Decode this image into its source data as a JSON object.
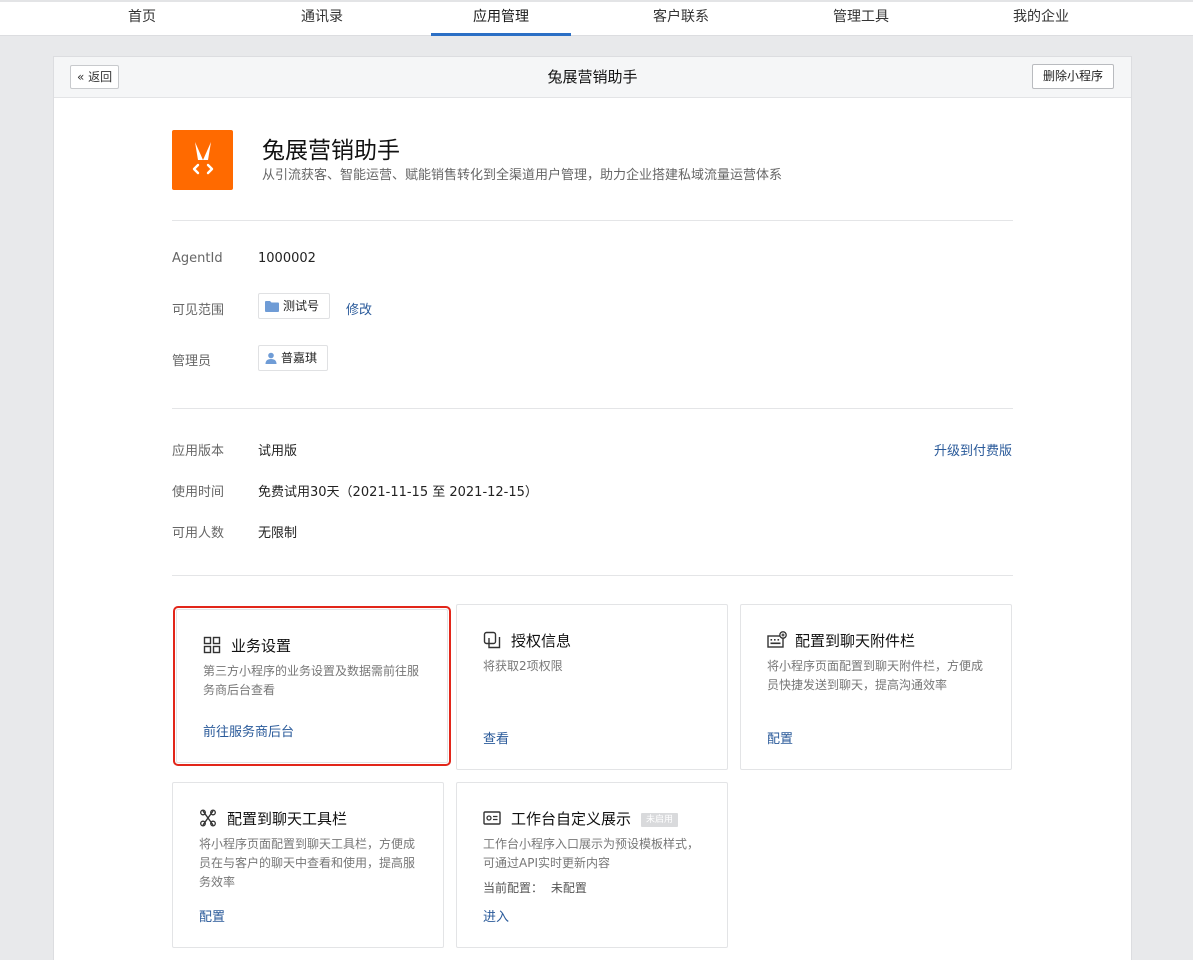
{
  "nav": {
    "tabs": [
      {
        "label": "首页"
      },
      {
        "label": "通讯录"
      },
      {
        "label": "应用管理"
      },
      {
        "label": "客户联系"
      },
      {
        "label": "管理工具"
      },
      {
        "label": "我的企业"
      }
    ],
    "active_index": 2
  },
  "header": {
    "back_label": "返回",
    "title": "兔展营销助手",
    "delete_label": "删除小程序"
  },
  "app": {
    "name": "兔展营销助手",
    "description": "从引流获客、智能运营、赋能销售转化到全渠道用户管理，助力企业搭建私域流量运营体系",
    "logo_color": "#ff6a00"
  },
  "details": {
    "agentid_label": "AgentId",
    "agentid_value": "1000002",
    "scope_label": "可见范围",
    "scope_value": "测试号",
    "scope_edit": "修改",
    "admin_label": "管理员",
    "admin_value": "普嘉琪"
  },
  "license": {
    "version_label": "应用版本",
    "version_value": "试用版",
    "upgrade_link": "升级到付费版",
    "period_label": "使用时间",
    "period_value": "免费试用30天（2021-11-15 至 2021-12-15）",
    "seats_label": "可用人数",
    "seats_value": "无限制"
  },
  "cards": [
    {
      "title": "业务设置",
      "desc": "第三方小程序的业务设置及数据需前往服务商后台查看",
      "action": "前往服务商后台",
      "icon": "grid-icon"
    },
    {
      "title": "授权信息",
      "desc": "将获取2项权限",
      "action": "查看",
      "icon": "copy-icon"
    },
    {
      "title": "配置到聊天附件栏",
      "desc": "将小程序页面配置到聊天附件栏，方便成员快捷发送到聊天，提高沟通效率",
      "action": "配置",
      "icon": "keyboard-icon"
    },
    {
      "title": "配置到聊天工具栏",
      "desc": "将小程序页面配置到聊天工具栏，方便成员在与客户的聊天中查看和使用，提高服务效率",
      "action": "配置",
      "icon": "tools-icon"
    },
    {
      "title": "工作台自定义展示",
      "badge": "未启用",
      "desc": "工作台小程序入口展示为预设模板样式，可通过API实时更新内容",
      "extra_label": "当前配置：",
      "extra_value": "未配置",
      "action": "进入",
      "icon": "card-icon"
    }
  ],
  "colors": {
    "accent": "#2b6fc5",
    "link": "#2a5a9a",
    "highlight_border": "#e2261a"
  }
}
